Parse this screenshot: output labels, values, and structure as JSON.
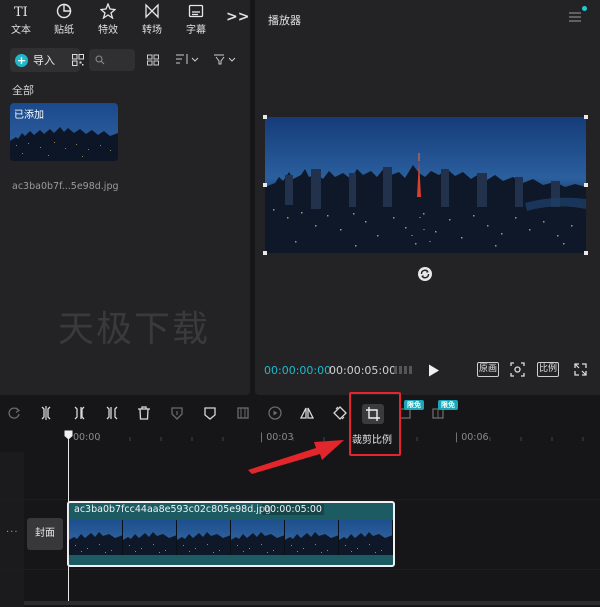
{
  "tool_tabs": [
    {
      "label": "文本",
      "icon": "text-icon"
    },
    {
      "label": "贴纸",
      "icon": "sticker-icon"
    },
    {
      "label": "特效",
      "icon": "effects-icon"
    },
    {
      "label": "转场",
      "icon": "transition-icon"
    },
    {
      "label": "字幕",
      "icon": "subtitle-icon"
    }
  ],
  "media": {
    "import_label": "导入",
    "search_placeholder": "",
    "all_label": "全部",
    "added_badge": "已添加",
    "file_name": "ac3ba0b7f...5e98d.jpg"
  },
  "watermark": "天极下载",
  "player": {
    "title": "播放器",
    "time_current": "00:00:00:00",
    "time_total": "00:00:05:00",
    "original_label": "原画",
    "ratio_label": "比例"
  },
  "toolbar": {
    "crop_tooltip": "裁剪比例",
    "free_badge_1": "限免",
    "free_badge_2": "限免"
  },
  "ruler": {
    "labels": [
      "00:00",
      "| 00:03",
      "| 00:06"
    ]
  },
  "track": {
    "cover_label": "封面",
    "more_label": "···",
    "clip_name": "ac3ba0b7fcc44aa8e593c02c805e98d.jpg",
    "clip_duration": "00:00:05:00"
  },
  "colors": {
    "accent": "#1fb8c9",
    "highlight": "#e3262b",
    "clip_bg": "#1c5b62"
  }
}
